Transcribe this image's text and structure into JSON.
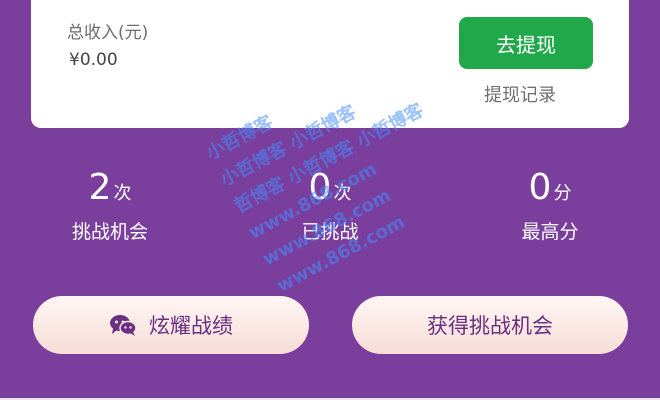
{
  "card": {
    "income_label": "总收入(元)",
    "income_value": "¥0.00",
    "withdraw_button": "去提现",
    "withdraw_record": "提现记录"
  },
  "stats": [
    {
      "num": "2",
      "unit": "次",
      "label": "挑战机会"
    },
    {
      "num": "0",
      "unit": "次",
      "label": "已挑战"
    },
    {
      "num": "0",
      "unit": "分",
      "label": "最高分"
    }
  ],
  "actions": {
    "share_label": "炫耀战绩",
    "get_chance_label": "获得挑战机会",
    "share_icon": "wechat-icon"
  },
  "watermark": {
    "lines": [
      "小哲博客",
      "小哲博客 小哲博客",
      "哲博客 小哲博客 小哲博客",
      "www.868.com",
      "www.868.com",
      "www.868.com"
    ]
  },
  "colors": {
    "background": "#7a3f9c",
    "button_green": "#21a84a",
    "pill_text": "#6a2e83"
  }
}
